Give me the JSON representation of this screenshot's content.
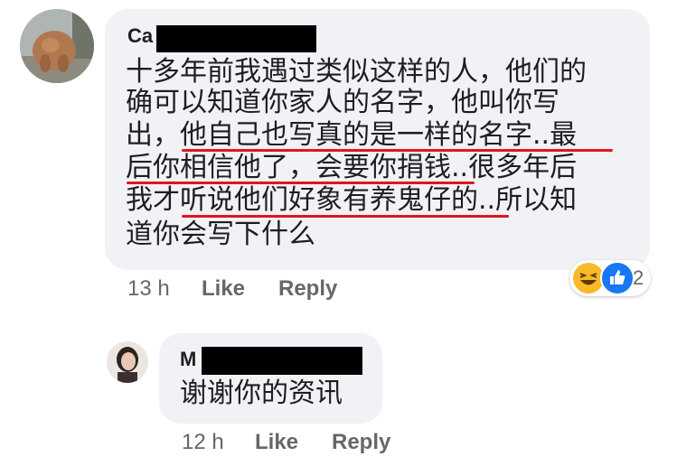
{
  "comment": {
    "author_visible": "Ca",
    "lines": [
      "十多年前我遇过类似这样的人，他们的",
      "确可以知道你家人的名字，他叫你写",
      "出，他自己也写真的是一样的名字..最",
      "后你相信他了，会要你捐钱..很多年后",
      "我才听说他们好象有养鬼仔的..所以知",
      "道你会写下什么"
    ],
    "time": "13 h",
    "like_label": "Like",
    "reply_label": "Reply",
    "reactions": {
      "icons": [
        "haha-icon",
        "like-icon"
      ],
      "count": "2"
    }
  },
  "reply": {
    "author_visible": "M",
    "text": "谢谢你的资讯",
    "time": "12 h",
    "like_label": "Like",
    "reply_label": "Reply"
  },
  "colors": {
    "bubble": "#f0f2f5",
    "underline": "#e0161e",
    "meta": "#65676b",
    "like_blue": "#1877f2",
    "haha_yellow": "#f7b928"
  }
}
